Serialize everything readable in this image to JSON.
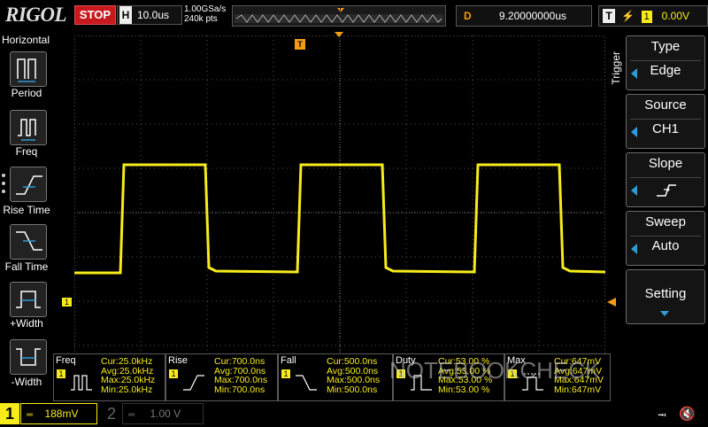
{
  "header": {
    "brand": "RIGOL",
    "run_state": "STOP",
    "timebase_letter": "H",
    "timebase": "10.0us",
    "sample_rate": "1.00GSa/s",
    "memory_depth": "240k pts",
    "delay_letter": "D",
    "delay": "9.20000000us",
    "trigger_letter": "T",
    "trigger_channel": "1",
    "trigger_level": "0.00V"
  },
  "left_menu": {
    "title": "Horizontal",
    "items": [
      {
        "label": "Period",
        "icon": "period-icon"
      },
      {
        "label": "Freq",
        "icon": "frequency-icon"
      },
      {
        "label": "Rise Time",
        "icon": "rise-time-icon"
      },
      {
        "label": "Fall Time",
        "icon": "fall-time-icon"
      },
      {
        "label": "+Width",
        "icon": "positive-width-icon"
      },
      {
        "label": "-Width",
        "icon": "negative-width-icon"
      }
    ]
  },
  "right_menu": {
    "title": "Trigger",
    "type": {
      "label": "Type",
      "value": "Edge"
    },
    "source": {
      "label": "Source",
      "value": "CH1"
    },
    "slope": {
      "label": "Slope",
      "icon": "rising-edge-icon"
    },
    "sweep": {
      "label": "Sweep",
      "value": "Auto"
    },
    "setting": {
      "label": "Setting"
    }
  },
  "markers": {
    "channel_marker": "1",
    "trigger_top": "T"
  },
  "measurements": [
    {
      "name": "Freq",
      "channel": "1",
      "lines": [
        "Cur:25.0kHz",
        "Avg:25.0kHz",
        "Max:25.0kHz",
        "Min:25.0kHz"
      ]
    },
    {
      "name": "Rise",
      "channel": "1",
      "lines": [
        "Cur:700.0ns",
        "Avg:700.0ns",
        "Max:700.0ns",
        "Min:700.0ns"
      ]
    },
    {
      "name": "Fall",
      "channel": "1",
      "lines": [
        "Cur:500.0ns",
        "Avg:500.0ns",
        "Max:500.0ns",
        "Min:500.0ns"
      ]
    },
    {
      "name": "Duty",
      "channel": "1",
      "lines": [
        "Cur:53.00 %",
        "Avg:53.00 %",
        "Max:53.00 %",
        "Min:53.00 %"
      ]
    },
    {
      "name": "Max",
      "channel": "1",
      "lines": [
        "Cur:647mV",
        "Avg:647mV",
        "Max:647mV",
        "Min:647mV"
      ]
    }
  ],
  "footer": {
    "ch1_number": "1",
    "ch1_scale": "188mV",
    "ch2_number": "2",
    "ch2_scale": "1.00 V"
  },
  "watermark": "NOTEBOOKCHECK",
  "colors": {
    "ch1": "#f7ec1a",
    "trigger": "#f39c12",
    "accent": "#2e9bd6",
    "stop": "#c8191f"
  }
}
